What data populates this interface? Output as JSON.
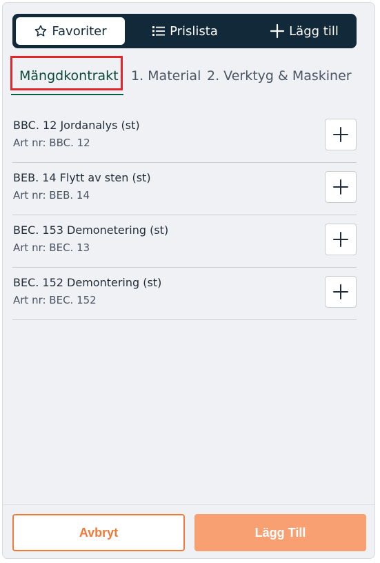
{
  "topnav": {
    "favorites_label": "Favoriter",
    "pricelist_label": "Prislista",
    "add_label": "Lägg till"
  },
  "tabs": [
    {
      "label": "Mängdkontrakt"
    },
    {
      "label": "1. Material"
    },
    {
      "label": "2. Verktyg & Maskiner"
    }
  ],
  "items": [
    {
      "title": "BBC. 12 Jordanalys (st)",
      "sub": "Art nr: BBC. 12"
    },
    {
      "title": "BEB. 14 Flytt av sten (st)",
      "sub": "Art nr: BEB. 14"
    },
    {
      "title": "BEC. 153 Demonetering (st)",
      "sub": "Art nr: BEC. 13"
    },
    {
      "title": "BEC. 152 Demontering (st)",
      "sub": "Art nr: BEC. 152"
    }
  ],
  "footer": {
    "cancel_label": "Avbryt",
    "add_label": "Lägg Till"
  },
  "colors": {
    "nav_bg": "#12293a",
    "active_tab": "#0b4a37",
    "highlight": "#e0252d",
    "orange": "#f07a3a",
    "orange_disabled": "#f8a071"
  }
}
